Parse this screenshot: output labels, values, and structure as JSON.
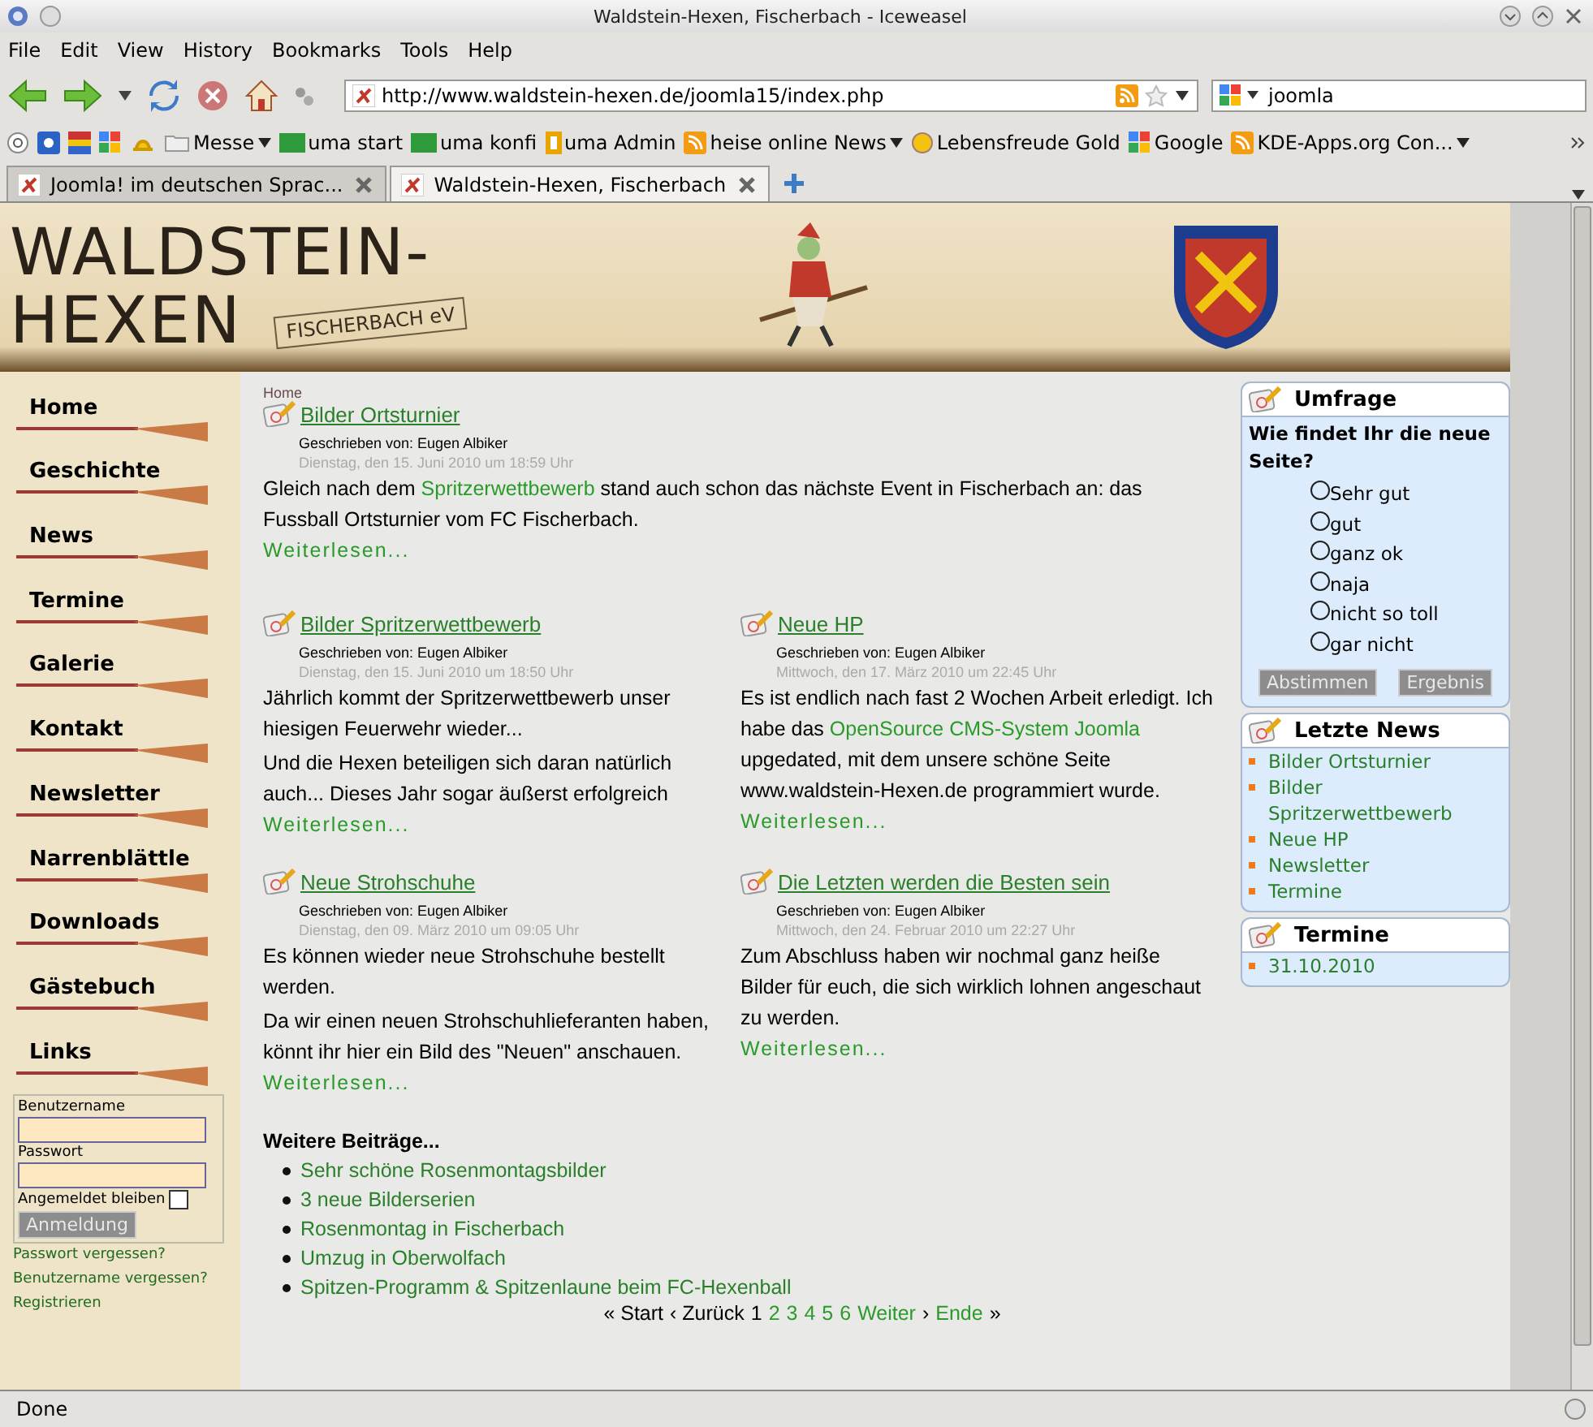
{
  "window": {
    "title": "Waldstein-Hexen, Fischerbach - Iceweasel"
  },
  "menu": [
    "File",
    "Edit",
    "View",
    "History",
    "Bookmarks",
    "Tools",
    "Help"
  ],
  "address": {
    "value": "http://www.waldstein-hexen.de/joomla15/index.php"
  },
  "search": {
    "value": "joomla"
  },
  "bookmarks": [
    {
      "label": "Messe",
      "kind": "folder"
    },
    {
      "label": "uma start",
      "kind": "site"
    },
    {
      "label": "uma konfi",
      "kind": "site"
    },
    {
      "label": "uma Admin",
      "kind": "page"
    },
    {
      "label": "heise online News",
      "kind": "feed"
    },
    {
      "label": "Lebensfreude Gold",
      "kind": "smiley"
    },
    {
      "label": "Google",
      "kind": "google"
    },
    {
      "label": "KDE-Apps.org Con...",
      "kind": "feed"
    }
  ],
  "tabs": [
    {
      "label": "Joomla! im deutschen Sprac...",
      "selected": false
    },
    {
      "label": "Waldstein-Hexen, Fischerbach",
      "selected": true
    }
  ],
  "site": {
    "logo_line_1": "WALDSTEIN-",
    "logo_line_2": "HEXEN",
    "logo_tag": "FISCHERBACH eV"
  },
  "nav": [
    "Home",
    "Geschichte",
    "News",
    "Termine",
    "Galerie",
    "Kontakt",
    "Newsletter",
    "Narrenblättle",
    "Downloads",
    "Gästebuch",
    "Links"
  ],
  "login": {
    "username_label": "Benutzername",
    "password_label": "Passwort",
    "remember_label": "Angemeldet bleiben",
    "remember_checked": false,
    "button": "Anmeldung",
    "links": [
      "Passwort vergessen?",
      "Benutzername vergessen?",
      "Registrieren"
    ]
  },
  "breadcrumb": "Home",
  "articles": [
    {
      "title": "Bilder Ortsturnier",
      "author": "Geschrieben von: Eugen Albiker",
      "date": "Dienstag, den 15. Juni 2010 um 18:59 Uhr",
      "paragraphs": [
        [
          {
            "kind": "text",
            "text": "Gleich nach dem "
          },
          {
            "kind": "link",
            "text": "Spritzerwettbewerb"
          },
          {
            "kind": "text",
            "text": " stand auch schon das nächste Event in Fischerbach an: das Fussball Ortsturnier vom FC Fischerbach."
          }
        ]
      ],
      "readmore": "Weiterlesen..."
    },
    {
      "title": "Bilder Spritzerwettbewerb",
      "author": "Geschrieben von: Eugen Albiker",
      "date": "Dienstag, den 15. Juni 2010 um 18:50 Uhr",
      "paragraphs": [
        [
          {
            "kind": "text",
            "text": "Jährlich kommt der Spritzerwettbewerb unser hiesigen Feuerwehr wieder..."
          }
        ],
        [
          {
            "kind": "text",
            "text": "Und die Hexen beteiligen sich daran natürlich auch... Dieses Jahr sogar äußerst erfolgreich"
          }
        ]
      ],
      "readmore": "Weiterlesen..."
    },
    {
      "title": "Neue HP",
      "author": "Geschrieben von: Eugen Albiker",
      "date": "Mittwoch, den 17. März 2010 um 22:45 Uhr",
      "paragraphs": [
        [
          {
            "kind": "text",
            "text": "Es ist endlich nach fast 2 Wochen Arbeit erledigt. Ich habe das "
          },
          {
            "kind": "link",
            "text": "OpenSource CMS-System Joomla"
          },
          {
            "kind": "text",
            "text": " upgedated, mit dem unsere schöne Seite www.waldstein-Hexen.de programmiert wurde."
          }
        ]
      ],
      "readmore": "Weiterlesen..."
    },
    {
      "title": "Neue Strohschuhe",
      "author": "Geschrieben von: Eugen Albiker",
      "date": "Dienstag, den 09. März 2010 um 09:05 Uhr",
      "paragraphs": [
        [
          {
            "kind": "text",
            "text": "Es können wieder neue Strohschuhe bestellt werden."
          }
        ],
        [
          {
            "kind": "text",
            "text": "Da wir einen neuen Strohschuhlieferanten haben, könnt ihr hier ein Bild des \"Neuen\" anschauen."
          }
        ]
      ],
      "readmore": "Weiterlesen..."
    },
    {
      "title": "Die Letzten werden die Besten sein",
      "author": "Geschrieben von: Eugen Albiker",
      "date": "Mittwoch, den 24. Februar 2010 um 22:27 Uhr",
      "paragraphs": [
        [
          {
            "kind": "text",
            "text": "Zum Abschluss haben wir nochmal ganz heiße Bilder für euch, die sich wirklich lohnen angeschaut zu werden."
          }
        ]
      ],
      "readmore": "Weiterlesen..."
    }
  ],
  "more": {
    "heading": "Weitere Beiträge...",
    "items": [
      "Sehr schöne Rosenmontagsbilder",
      "3 neue Bilderserien",
      "Rosenmontag in Fischerbach",
      "Umzug in Oberwolfach",
      "Spitzen-Programm & Spitzenlaune beim FC-Hexenball"
    ]
  },
  "pagination": [
    {
      "label": "« Start",
      "kind": "text"
    },
    {
      "label": "‹ Zurück",
      "kind": "text"
    },
    {
      "label": "1",
      "kind": "text"
    },
    {
      "label": "2",
      "kind": "link"
    },
    {
      "label": "3",
      "kind": "link"
    },
    {
      "label": "4",
      "kind": "link"
    },
    {
      "label": "5",
      "kind": "link"
    },
    {
      "label": "6",
      "kind": "link"
    },
    {
      "label": "Weiter",
      "kind": "link"
    },
    {
      "label": "›",
      "kind": "text"
    },
    {
      "label": "Ende",
      "kind": "link"
    },
    {
      "label": "»",
      "kind": "text"
    }
  ],
  "poll": {
    "title": "Umfrage",
    "question": "Wie findet Ihr die neue Seite?",
    "options": [
      {
        "label": "Sehr gut",
        "selected": false
      },
      {
        "label": "gut",
        "selected": false
      },
      {
        "label": "ganz ok",
        "selected": false
      },
      {
        "label": "naja",
        "selected": false
      },
      {
        "label": "nicht so toll",
        "selected": false
      },
      {
        "label": "gar nicht",
        "selected": false
      }
    ],
    "buttons": [
      "Abstimmen",
      "Ergebnis"
    ]
  },
  "latest": {
    "title": "Letzte News",
    "items": [
      "Bilder Ortsturnier",
      "Bilder Spritzerwettbewerb",
      "Neue HP",
      "Newsletter",
      "Termine"
    ]
  },
  "events": {
    "title": "Termine",
    "items": [
      "31.10.2010"
    ]
  },
  "status_bar": "Done"
}
